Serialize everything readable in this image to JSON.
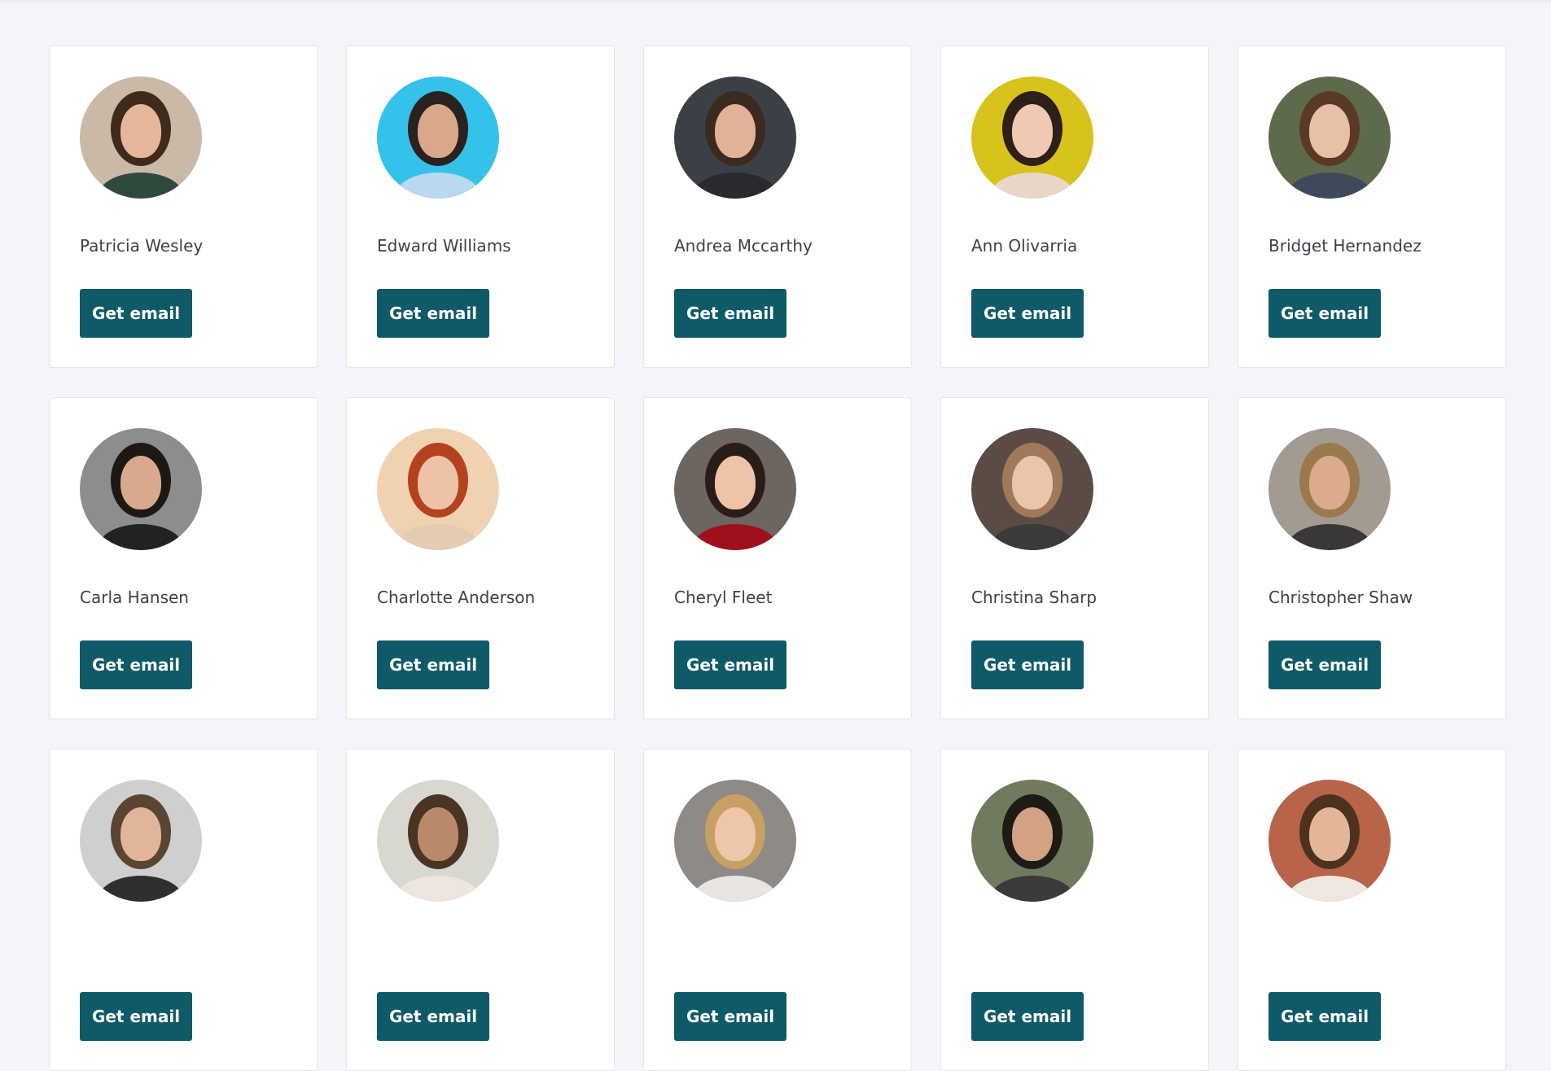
{
  "button_label": "Get email",
  "cards": [
    {
      "name": "Patricia Wesley",
      "bg": "#c9b9a6",
      "hair": "#3f2a1c",
      "skin": "#e5b79a",
      "shirt": "#2f4a3c"
    },
    {
      "name": "Edward Williams",
      "bg": "#35c2ea",
      "hair": "#2a2220",
      "skin": "#d9a88a",
      "shirt": "#b9d9ef"
    },
    {
      "name": "Andrea Mccarthy",
      "bg": "#3c4046",
      "hair": "#3a2a20",
      "skin": "#e2b296",
      "shirt": "#2a2a2e"
    },
    {
      "name": "Ann Olivarria",
      "bg": "#d8c21c",
      "hair": "#2c2018",
      "skin": "#f0c9b4",
      "shirt": "#e8d6c8"
    },
    {
      "name": "Bridget Hernandez",
      "bg": "#5d6a4c",
      "hair": "#5a3a26",
      "skin": "#e8c0a8",
      "shirt": "#3e4a5c"
    },
    {
      "name": "Carla Hansen",
      "bg": "#8d8d8d",
      "hair": "#1e1814",
      "skin": "#d9a98e",
      "shirt": "#222222"
    },
    {
      "name": "Charlotte Anderson",
      "bg": "#f1d2b0",
      "hair": "#b5421e",
      "skin": "#edc2a6",
      "shirt": "#e4cbb3"
    },
    {
      "name": "Cheryl Fleet",
      "bg": "#6c6560",
      "hair": "#2a1c16",
      "skin": "#efc3a8",
      "shirt": "#a0101c"
    },
    {
      "name": "Christina Sharp",
      "bg": "#5a4c44",
      "hair": "#a0785a",
      "skin": "#ecc4ac",
      "shirt": "#3a3a3a"
    },
    {
      "name": "Christopher Shaw",
      "bg": "#a39a92",
      "hair": "#9a7a4c",
      "skin": "#dcaa8c",
      "shirt": "#3a3836"
    },
    {
      "name": "",
      "bg": "#cfcfcf",
      "hair": "#5a4432",
      "skin": "#e0b59a",
      "shirt": "#2e2e2e"
    },
    {
      "name": "",
      "bg": "#d8d8d0",
      "hair": "#4a3424",
      "skin": "#b98a6a",
      "shirt": "#ede6de"
    },
    {
      "name": "",
      "bg": "#8e8a86",
      "hair": "#c8a064",
      "skin": "#eec6aa",
      "shirt": "#e8e4e0"
    },
    {
      "name": "",
      "bg": "#6f7a5e",
      "hair": "#1e1a16",
      "skin": "#d2a282",
      "shirt": "#3a3a3a"
    },
    {
      "name": "",
      "bg": "#b8644a",
      "hair": "#4e3220",
      "skin": "#e4b698",
      "shirt": "#f0e8e0"
    }
  ]
}
